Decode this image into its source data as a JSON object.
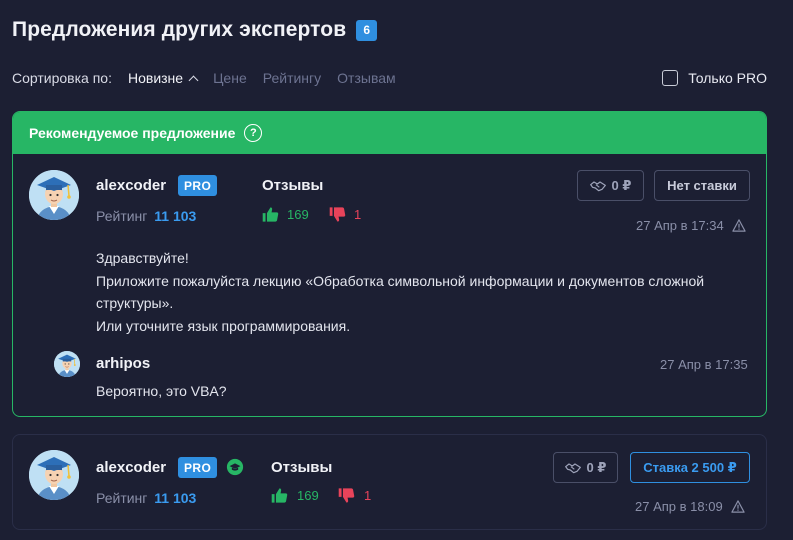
{
  "header": {
    "title": "Предложения других экспертов",
    "count": "6"
  },
  "sort": {
    "label": "Сортировка по:",
    "options": [
      "Новизне",
      "Цене",
      "Рейтингу",
      "Отзывам"
    ],
    "active_index": 0
  },
  "filter": {
    "pro_only_label": "Только PRO",
    "checked": false
  },
  "recommended": {
    "heading": "Рекомендуемое предложение",
    "help_glyph": "?",
    "offer": {
      "username": "alexcoder",
      "badge": "PRO",
      "rating_label": "Рейтинг",
      "rating_value": "11 103",
      "reviews_label": "Отзывы",
      "likes": "169",
      "dislikes": "1",
      "price": "0 ₽",
      "action_label": "Нет ставки",
      "date": "27 Апр в 17:34",
      "message_lines": [
        "Здравствуйте!",
        "Приложите пожалуйста лекцию «Обработка символьной информации и документов сложной структуры».",
        "Или уточните язык программирования."
      ]
    },
    "reply": {
      "username": "arhipos",
      "date": "27 Апр в 17:35",
      "text": "Вероятно, это VBA?"
    }
  },
  "offers": [
    {
      "username": "alexcoder",
      "badge": "PRO",
      "rating_label": "Рейтинг",
      "rating_value": "11 103",
      "reviews_label": "Отзывы",
      "likes": "169",
      "dislikes": "1",
      "price": "0 ₽",
      "action_label": "Ставка 2 500 ₽",
      "date": "27 Апр в 18:09"
    }
  ],
  "colors": {
    "background": "#1c1f33",
    "accent_green": "#27b665",
    "accent_blue": "#2f8fe0",
    "dislike_red": "#e8435a"
  },
  "icons": [
    "help-icon",
    "chevron-up-icon",
    "thumbs-up-icon",
    "thumbs-down-icon",
    "handshake-icon",
    "warning-icon",
    "verified-icon"
  ]
}
